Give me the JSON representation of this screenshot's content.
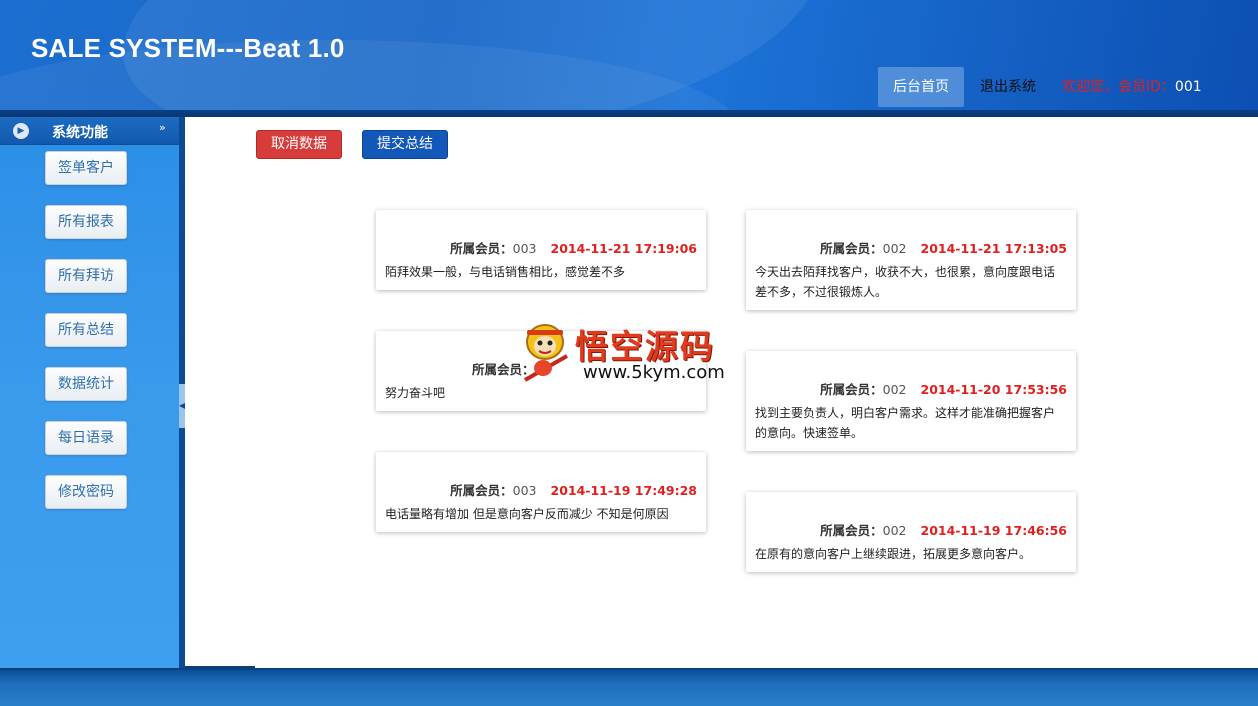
{
  "app": {
    "title": "SALE SYSTEM---Beat 1.0"
  },
  "topnav": {
    "home": "后台首页",
    "logout": "退出系统",
    "welcome_label": "欢迎您，会员ID：",
    "member_id": "001"
  },
  "sidebar": {
    "title": "系统功能",
    "items": [
      {
        "label": "签单客户"
      },
      {
        "label": "所有报表"
      },
      {
        "label": "所有拜访"
      },
      {
        "label": "所有总结"
      },
      {
        "label": "数据统计"
      },
      {
        "label": "每日语录"
      },
      {
        "label": "修改密码"
      }
    ]
  },
  "actions": {
    "cancel": "取消数据",
    "submit": "提交总结"
  },
  "cards": [
    {
      "member_label": "所属会员：",
      "member": "003",
      "time": "2014-11-21 17:19:06",
      "text": "陌拜效果一般，与电话销售相比，感觉差不多"
    },
    {
      "member_label": "所属会员：",
      "member": "002",
      "time": "2014-11-21 17:13:05",
      "text": "今天出去陌拜找客户，收获不大，也很累，意向度跟电话差不多，不过很锻炼人。"
    },
    {
      "member_label": "所属会员：",
      "member": "",
      "time": "",
      "text": "努力奋斗吧"
    },
    {
      "member_label": "所属会员：",
      "member": "002",
      "time": "2014-11-20 17:53:56",
      "text": "找到主要负责人，明白客户需求。这样才能准确把握客户的意向。快速签单。"
    },
    {
      "member_label": "所属会员：",
      "member": "003",
      "time": "2014-11-19 17:49:28",
      "text": "电话量略有增加 但是意向客户反而减少 不知是何原因"
    },
    {
      "member_label": "所属会员：",
      "member": "002",
      "time": "2014-11-19 17:46:56",
      "text": "在原有的意向客户上继续跟进，拓展更多意向客户。"
    }
  ],
  "watermark": {
    "brand": "悟空源码",
    "url": "www.5kym.com"
  },
  "colors": {
    "accent_red": "#e0201e",
    "primary_blue": "#1158b8",
    "sidebar_blue": "#3a9aec"
  }
}
